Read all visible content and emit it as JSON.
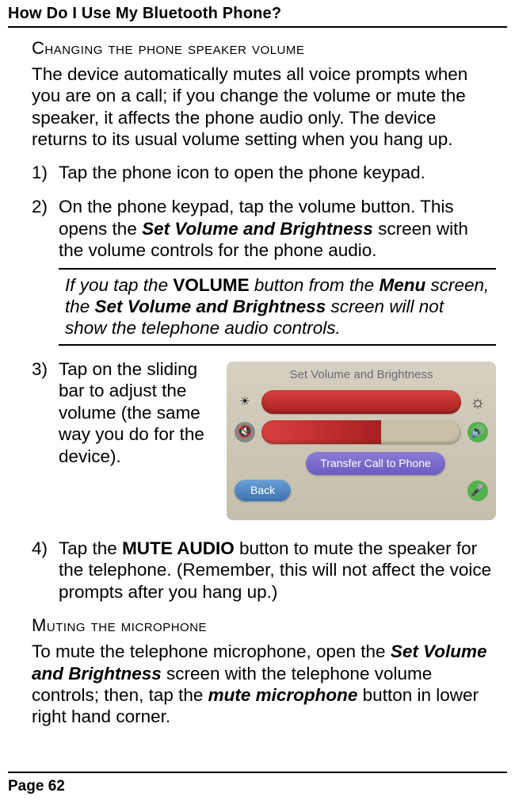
{
  "header": "How Do I Use My Bluetooth Phone?",
  "section1_heading": "Changing the phone speaker volume",
  "section1_intro": "The device automatically mutes all voice prompts when you are on a call; if you change the volume or mute the speaker, it affects the phone audio only. The device returns to its usual volume setting when you hang up.",
  "steps": {
    "s1": "Tap the phone icon to open the phone keypad.",
    "s2a": "On the phone keypad, tap the volume button. This opens the ",
    "s2_bold": "Set Volume and Brightness",
    "s2b": " screen with the volume controls for the phone audio.",
    "note_a": "If you tap the ",
    "note_vol": "VOLUME",
    "note_b": " button from the ",
    "note_menu": "Menu",
    "note_c": " screen, the ",
    "note_svb": "Set Volume and Brightness",
    "note_d": " screen will not show the telephone audio controls.",
    "s3": "Tap on the sliding bar to adjust the volume (the same way you do for the device).",
    "s4a": "Tap the ",
    "s4_mute": "MUTE AUDIO",
    "s4b": " button to mute the speaker for the telephone. (Remember, this will not affect the voice prompts after you hang up.)"
  },
  "screenshot": {
    "title": "Set Volume and Brightness",
    "transfer": "Transfer Call to Phone",
    "back": "Back"
  },
  "section2_heading": "Muting the microphone",
  "section2_a": "To mute the telephone microphone, open the ",
  "section2_svb": "Set Volume and Brightness",
  "section2_b": " screen with the telephone volume controls; then, tap the ",
  "section2_mm": "mute microphone",
  "section2_c": " button in lower right hand corner.",
  "footer": "Page 62"
}
